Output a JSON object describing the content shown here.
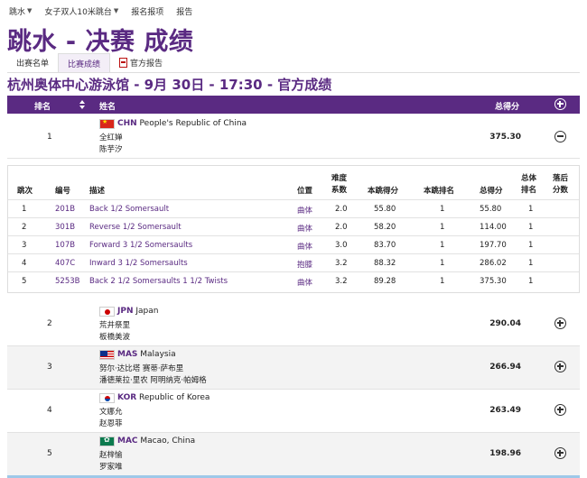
{
  "nav": {
    "items": [
      {
        "label": "跳水",
        "dropdown": true
      },
      {
        "label": "女子双人10米跳台",
        "dropdown": true
      },
      {
        "label": "报名报项",
        "dropdown": false
      },
      {
        "label": "报告",
        "dropdown": false
      }
    ]
  },
  "page_title": "跳水 - 决赛 成绩",
  "tabs": [
    {
      "label": "出赛名单",
      "active": false
    },
    {
      "label": "比赛成绩",
      "active": true
    },
    {
      "label": "官方报告",
      "active": false,
      "icon": "pdf-icon"
    }
  ],
  "subtitle": "杭州奥体中心游泳馆 - 9月 30日 - 17:30 - 官方成绩",
  "results_header": {
    "rank": "排名",
    "name": "姓名",
    "total": "总得分"
  },
  "teams": [
    {
      "rank": "1",
      "code": "CHN",
      "country": "People's Republic of China",
      "flag": "chn",
      "athletes": [
        "全红婵",
        "陈芋汐"
      ],
      "total": "375.30",
      "expanded": true
    },
    {
      "rank": "2",
      "code": "JPN",
      "country": "Japan",
      "flag": "jpn",
      "athletes": [
        "荒井祭里",
        "板橋美波"
      ],
      "total": "290.04",
      "expanded": false
    },
    {
      "rank": "3",
      "code": "MAS",
      "country": "Malaysia",
      "flag": "mas",
      "athletes": [
        "努尔·达比塔 赛蒂·萨布里",
        "潘德莱拉·里农 阿明纳克·帕姆格"
      ],
      "total": "266.94",
      "expanded": false
    },
    {
      "rank": "4",
      "code": "KOR",
      "country": "Republic of Korea",
      "flag": "kor",
      "athletes": [
        "文娜允",
        "赵恩菲"
      ],
      "total": "263.49",
      "expanded": false
    },
    {
      "rank": "5",
      "code": "MAC",
      "country": "Macao, China",
      "flag": "mac",
      "athletes": [
        "赵梓愉",
        "罗家唯"
      ],
      "total": "198.96",
      "expanded": false
    }
  ],
  "dive_table": {
    "headers": {
      "round": "跳次",
      "number": "编号",
      "description": "描述",
      "position": "位置",
      "difficulty": [
        "难度",
        "系数"
      ],
      "score": "本跳得分",
      "round_rank": "本跳排名",
      "total": "总得分",
      "overall_rank": [
        "总体",
        "排名"
      ],
      "behind": [
        "落后",
        "分数"
      ]
    },
    "rows": [
      {
        "round": "1",
        "number": "201B",
        "description": "Back 1/2 Somersault",
        "position": "曲体",
        "difficulty": "2.0",
        "score": "55.80",
        "round_rank": "1",
        "total": "55.80",
        "overall_rank": "1"
      },
      {
        "round": "2",
        "number": "301B",
        "description": "Reverse 1/2 Somersault",
        "position": "曲体",
        "difficulty": "2.0",
        "score": "58.20",
        "round_rank": "1",
        "total": "114.00",
        "overall_rank": "1"
      },
      {
        "round": "3",
        "number": "107B",
        "description": "Forward 3 1/2 Somersaults",
        "position": "曲体",
        "difficulty": "3.0",
        "score": "83.70",
        "round_rank": "1",
        "total": "197.70",
        "overall_rank": "1"
      },
      {
        "round": "4",
        "number": "407C",
        "description": "Inward 3 1/2 Somersaults",
        "position": "抱膝",
        "difficulty": "3.2",
        "score": "88.32",
        "round_rank": "1",
        "total": "286.02",
        "overall_rank": "1"
      },
      {
        "round": "5",
        "number": "5253B",
        "description": "Back 2 1/2 Somersaults 1 1/2 Twists",
        "position": "曲体",
        "difficulty": "3.2",
        "score": "89.28",
        "round_rank": "1",
        "total": "375.30",
        "overall_rank": "1"
      }
    ]
  }
}
